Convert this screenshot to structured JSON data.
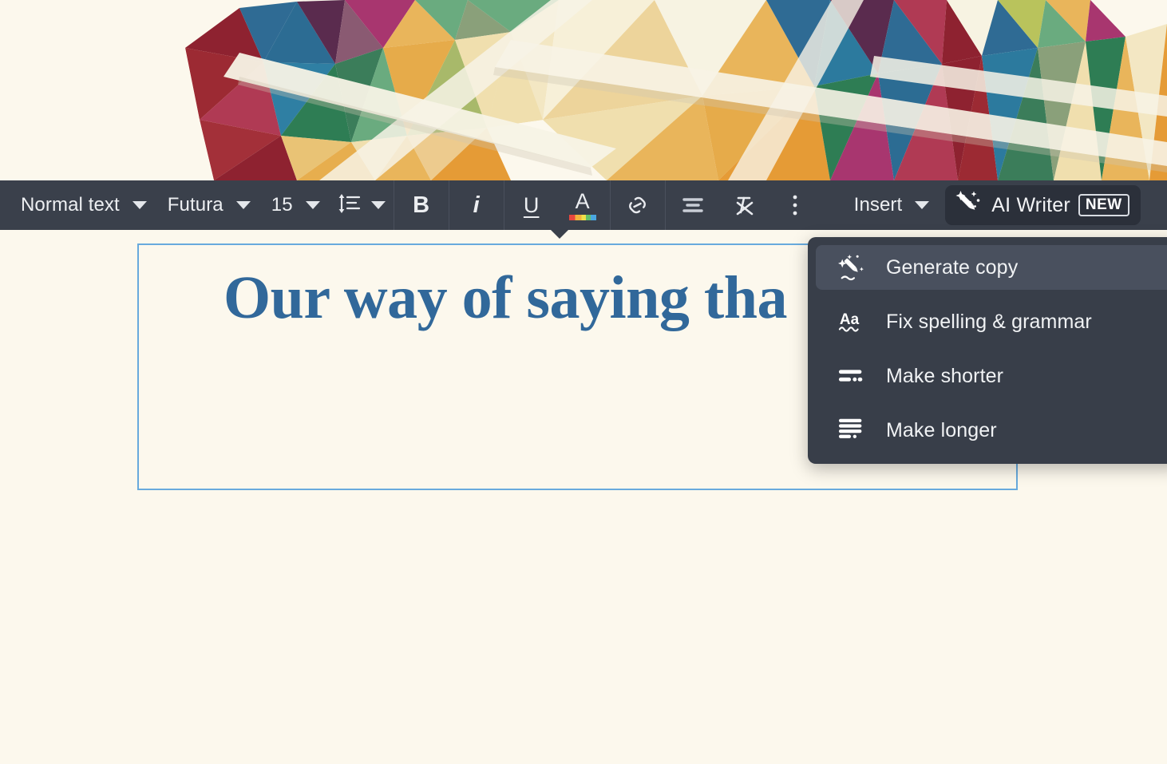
{
  "canvas": {
    "background_color": "#fcf8ed",
    "hero_image": {
      "name": "low-poly-triangles-collage",
      "palette": [
        "#f0dfae",
        "#e9b55b",
        "#e59b36",
        "#2f6b94",
        "#2c7a9e",
        "#3b7d5a",
        "#2e7d54",
        "#6aab7f",
        "#a8b96a",
        "#b9c35c",
        "#b03a54",
        "#8e2230",
        "#a8366f",
        "#5a2b4e",
        "#f7f3e2"
      ]
    },
    "textbox": {
      "selected": true,
      "border_color": "#68aadd",
      "headline": "Our way of saying tha",
      "headline_color": "#31689a"
    }
  },
  "toolbar": {
    "background_color": "#3a404b",
    "paragraph_style": "Normal text",
    "font_family": "Futura",
    "font_size": "15",
    "line_spacing_icon": "line-spacing-icon",
    "bold_label": "B",
    "italic_label": "i",
    "underline_label": "U",
    "text_color_label": "A",
    "link_icon": "link-icon",
    "align_icon": "align-center-icon",
    "clear_format_icon": "clear-formatting-icon",
    "more_icon": "more-vertical-icon",
    "insert_label": "Insert",
    "ai_writer": {
      "label": "AI Writer",
      "badge": "NEW",
      "icon": "magic-wand-icon",
      "background_color": "#2b303a"
    }
  },
  "ai_menu": {
    "background_color": "#383e49",
    "items": [
      {
        "label": "Generate copy",
        "icon": "magic-wand-pencil-icon",
        "active": true
      },
      {
        "label": "Fix spelling & grammar",
        "icon": "spellcheck-aa-icon",
        "active": false
      },
      {
        "label": "Make shorter",
        "icon": "make-shorter-lines-icon",
        "active": false
      },
      {
        "label": "Make longer",
        "icon": "make-longer-lines-icon",
        "active": false
      }
    ]
  }
}
